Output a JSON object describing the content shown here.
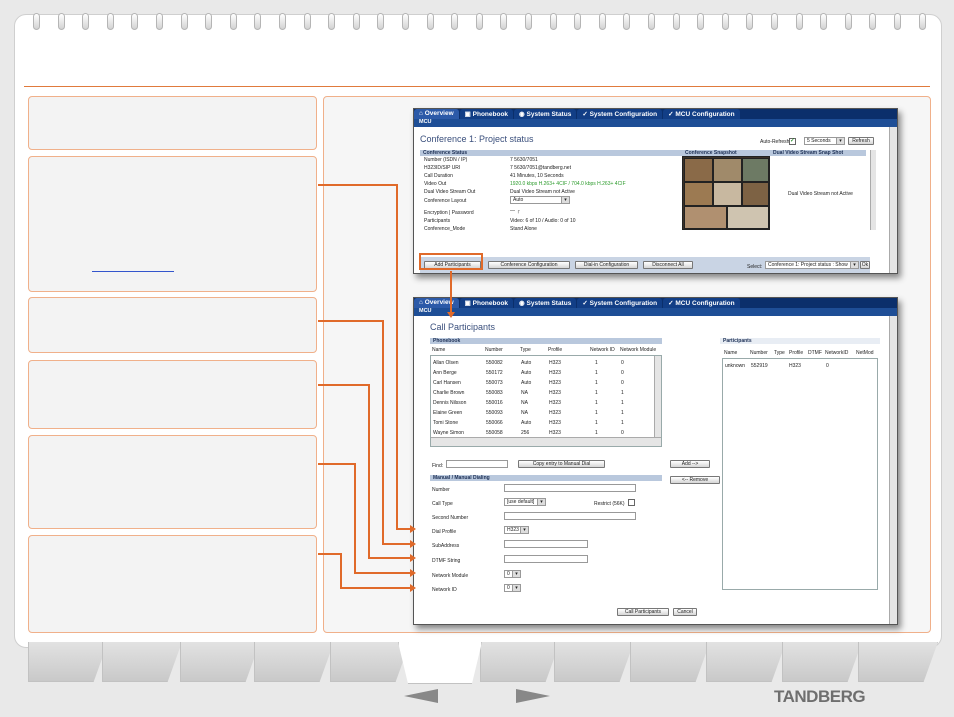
{
  "brand": {
    "logo_text": "TANDBERG"
  },
  "colors": {
    "accent": "#e06a2a",
    "nav_bar": "#0b2f6b",
    "section_header": "#b9c8dd",
    "title_text": "#3a4f7c"
  },
  "icons": {
    "prev": "left-arrow-icon",
    "next": "right-arrow-icon",
    "checkbox": "checkbox-icon",
    "dropdown": "chevron-down-icon",
    "tab_overview": "home-icon",
    "tab_phonebook": "book-icon",
    "tab_status": "info-icon",
    "tab_config": "wrench-icon"
  },
  "nav": {
    "tabs": [
      {
        "label": "Overview",
        "glyph": "⌂"
      },
      {
        "label": "Phonebook",
        "glyph": "▣"
      },
      {
        "label": "System Status",
        "glyph": "◉"
      },
      {
        "label": "System Configuration",
        "glyph": "✓"
      },
      {
        "label": "MCU Configuration",
        "glyph": "✓"
      }
    ],
    "sub_label": "MCU"
  },
  "conf": {
    "title": "Conference 1: Project status",
    "auto_refresh_label": "Auto-Refresh",
    "refresh_interval": "5 Seconds",
    "refresh_button": "Refresh",
    "status_header": "Conference Status",
    "snapshot_header": "Conference Snapshot",
    "dual_header": "Dual Video Stream Snap Shot",
    "dual_inactive": "Dual Video Stream not Active",
    "fields": [
      {
        "label": "Number (ISDN / IP)",
        "value": "7 5630/7051"
      },
      {
        "label": "H323ID/SIP URI",
        "value": "7 5630/7051@tandberg.net"
      },
      {
        "label": "Call Duration",
        "value": "41 Minutes, 10 Seconds"
      },
      {
        "label": "Video Out",
        "value": "1920.0 kbps H.263+ 4CIF / 704.0 kbps H.263+ 4CIF"
      },
      {
        "label": "Dual Video Stream Out",
        "value": "Dual Video Stream not Active"
      }
    ],
    "layout_label": "Conference Layout",
    "layout_value": "Auto",
    "encryption_label": "Encryption | Password",
    "encryption_value": "— ┌",
    "participants_label": "Participants",
    "participants_value": "Video: 6 of 10  / Audio: 0 of 10",
    "mode_label": "Conference_Mode",
    "mode_value": "Stand Alone",
    "buttons": {
      "add_participants": "Add Participants",
      "conference_configuration": "Conference Configuration",
      "dial_in_configuration": "Dial-in Configuration",
      "disconnect_all": "Disconnect All"
    },
    "select_label": "Select:",
    "select_value": "Conference 1: Project status : Show",
    "ok_label": "Ok"
  },
  "call": {
    "title": "Call Participants",
    "phonebook_header": "Phonebook",
    "columns": [
      "Name",
      "Number",
      "Type",
      "Profile",
      "Network ID",
      "Network Module"
    ],
    "rows": [
      {
        "name": "Allan Olsen",
        "number": "550082",
        "type": "Auto",
        "profile": "H323",
        "netid": "1",
        "module": "0"
      },
      {
        "name": "Ann Berge",
        "number": "550172",
        "type": "Auto",
        "profile": "H323",
        "netid": "1",
        "module": "0"
      },
      {
        "name": "Carl Hansen",
        "number": "550073",
        "type": "Auto",
        "profile": "H323",
        "netid": "1",
        "module": "0"
      },
      {
        "name": "Charlie Brown",
        "number": "550083",
        "type": "NA",
        "profile": "H323",
        "netid": "1",
        "module": "1"
      },
      {
        "name": "Dennis Nilsson",
        "number": "550016",
        "type": "NA",
        "profile": "H323",
        "netid": "1",
        "module": "1"
      },
      {
        "name": "Elaine Green",
        "number": "550093",
        "type": "NA",
        "profile": "H323",
        "netid": "1",
        "module": "1"
      },
      {
        "name": "Tomi Stone",
        "number": "550066",
        "type": "Auto",
        "profile": "H323",
        "netid": "1",
        "module": "1"
      },
      {
        "name": "Wayne Simon",
        "number": "550058",
        "type": "256",
        "profile": "H323",
        "netid": "1",
        "module": "0"
      }
    ],
    "find_label": "Find:",
    "copy_button": "Copy entry to Manual Dial",
    "manual_header": "Manual / Manual Dialing",
    "number_label": "Number",
    "call_type_label": "Call Type",
    "call_type_value": "[use default]",
    "restrict_label": "Restrict (56K)",
    "second_number_label": "Second Number",
    "dial_profile_label": "Dial Profile",
    "dial_profile_value": "H323",
    "subaddress_label": "SubAddress",
    "dtmf_label": "DTMF String",
    "network_module_label": "Network Module",
    "network_module_value": "0",
    "network_id_label": "Network ID",
    "network_id_value": "0",
    "add_button": "Add -->",
    "remove_button": "<-- Remove",
    "participants_header": "Participants",
    "p_columns": [
      "Name",
      "Number",
      "Type",
      "Profile",
      "DTMF",
      "NetworkID",
      "NetMod"
    ],
    "p_rows": [
      {
        "name": "unknown",
        "number": "552919",
        "type": "",
        "profile": "H323",
        "dtmf": "",
        "netid": "0",
        "module": ""
      }
    ],
    "call_button": "Call Participants",
    "cancel_button": "Cancel"
  }
}
